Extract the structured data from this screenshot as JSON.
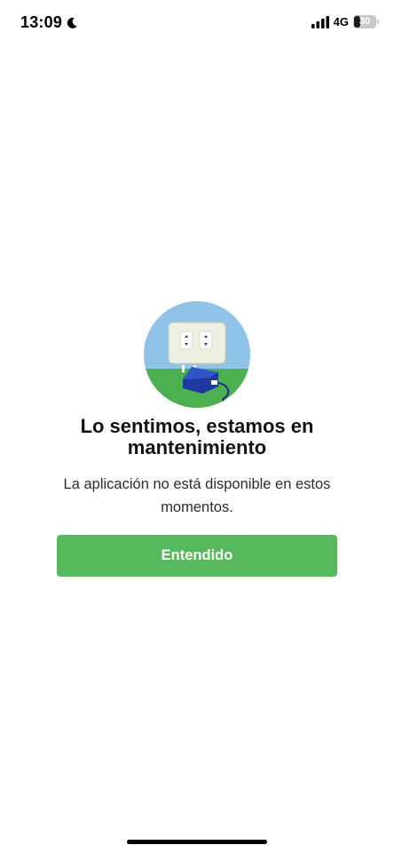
{
  "status_bar": {
    "time": "13:09",
    "network": "4G",
    "battery_level": "30",
    "icons": [
      "moon-icon",
      "signal-icon",
      "battery-icon"
    ]
  },
  "maintenance": {
    "illustration_icon": "unplugged-outlet-illustration",
    "title": "Lo sentimos, estamos en mantenimiento",
    "message": "La aplicación no está disponible en estos momentos.",
    "button_label": "Entendido"
  },
  "colors": {
    "button_green": "#56b95e",
    "sky_blue": "#8fc3e8",
    "grass_green": "#4caf50",
    "plug_blue": "#1f3a9c"
  }
}
